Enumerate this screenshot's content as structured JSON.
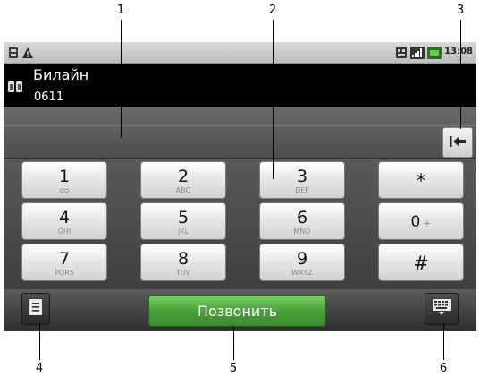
{
  "callouts": [
    "1",
    "2",
    "3",
    "4",
    "5",
    "6"
  ],
  "status_bar": {
    "time": "13:08",
    "left_icons": [
      "usb-icon",
      "warning-icon"
    ],
    "right_icons": [
      "sim-card-icon",
      "signal-icon",
      "battery-icon"
    ]
  },
  "carrier": {
    "name": "Билайн",
    "number": "0611"
  },
  "dialer_input": {
    "value": ""
  },
  "keypad": {
    "k1": {
      "digit": "1",
      "letters": "ᴑᴑ"
    },
    "k2": {
      "digit": "2",
      "letters": "ABC"
    },
    "k3": {
      "digit": "3",
      "letters": "DEF"
    },
    "kstar": {
      "digit": "*"
    },
    "k4": {
      "digit": "4",
      "letters": "GHI"
    },
    "k5": {
      "digit": "5",
      "letters": "JKL"
    },
    "k6": {
      "digit": "6",
      "letters": "MNO"
    },
    "k0": {
      "digit": "0",
      "extra": "+"
    },
    "k7": {
      "digit": "7",
      "letters": "PQRS"
    },
    "k8": {
      "digit": "8",
      "letters": "TUV"
    },
    "k9": {
      "digit": "9",
      "letters": "WXYZ"
    },
    "khash": {
      "digit": "#"
    }
  },
  "bottom_bar": {
    "call_label": "Позвонить"
  },
  "colors": {
    "call_button": "#4aa33a",
    "carrier_background": "#000000",
    "keypad_background": "#4a4a4a"
  }
}
